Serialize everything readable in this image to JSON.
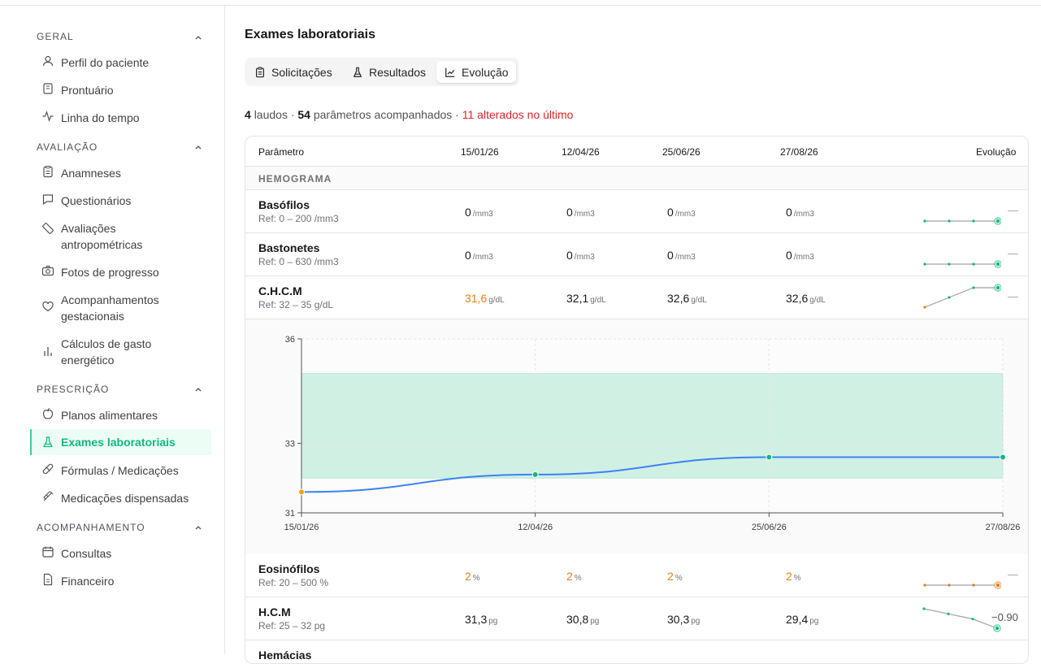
{
  "sidebar": {
    "sections": [
      {
        "title": "GERAL",
        "items": [
          "Perfil do paciente",
          "Prontuário",
          "Linha do tempo"
        ]
      },
      {
        "title": "AVALIAÇÃO",
        "items": [
          "Anamneses",
          "Questionários",
          "Avaliações antropométricas",
          "Fotos de progresso",
          "Acompanhamentos gestacionais",
          "Cálculos de gasto energético"
        ]
      },
      {
        "title": "PRESCRIÇÃO",
        "items": [
          "Planos alimentares",
          "Exames laboratoriais",
          "Fórmulas / Medicações",
          "Medicações dispensadas"
        ]
      },
      {
        "title": "ACOMPANHAMENTO",
        "items": [
          "Consultas",
          "Financeiro"
        ]
      }
    ],
    "labels": {
      "geral": "GERAL",
      "avaliacao": "AVALIAÇÃO",
      "prescricao": "PRESCRIÇÃO",
      "acompanhamento": "ACOMPANHAMENTO",
      "perfil": "Perfil do paciente",
      "prontuario": "Prontuário",
      "linha": "Linha do tempo",
      "anamneses": "Anamneses",
      "questionarios": "Questionários",
      "antropo1": "Avaliações",
      "antropo2": "antropométricas",
      "fotos": "Fotos de progresso",
      "gest1": "Acompanhamentos",
      "gest2": "gestacionais",
      "calc1": "Cálculos de gasto",
      "calc2": "energético",
      "planos": "Planos alimentares",
      "exames": "Exames laboratoriais",
      "formulas": "Fórmulas / Medicações",
      "medicacoes": "Medicações dispensadas",
      "consultas": "Consultas",
      "financeiro": "Financeiro"
    },
    "active": "Exames laboratoriais"
  },
  "page": {
    "title": "Exames laboratoriais",
    "tabs": {
      "solicitacoes": "Solicitações",
      "resultados": "Resultados",
      "evolucao": "Evolução"
    },
    "selected_tab": "Evolução",
    "summary": {
      "laudos_count": "4",
      "laudos_label": "laudos ·",
      "params_count": "54",
      "params_label": "parâmetros acompanhados ·",
      "altered": "11 alterados no último"
    }
  },
  "table": {
    "headers": {
      "param": "Parâmetro",
      "d1": "15/01/26",
      "d2": "12/04/26",
      "d3": "25/06/26",
      "d4": "27/08/26",
      "evo": "Evolução"
    },
    "group": "HEMOGRAMA",
    "rows": [
      {
        "name": "Basófilos",
        "ref": "Ref: 0 – 200 /mm3",
        "unit": "/mm3",
        "values": [
          "0",
          "0",
          "0",
          "0"
        ],
        "altered": [
          false,
          false,
          false,
          false
        ],
        "trend": "—"
      },
      {
        "name": "Bastonetes",
        "ref": "Ref: 0 – 630 /mm3",
        "unit": "/mm3",
        "values": [
          "0",
          "0",
          "0",
          "0"
        ],
        "altered": [
          false,
          false,
          false,
          false
        ],
        "trend": "—"
      },
      {
        "name": "C.H.C.M",
        "ref": "Ref: 32 – 35 g/dL",
        "unit": "g/dL",
        "values": [
          "31,6",
          "32,1",
          "32,6",
          "32,6"
        ],
        "altered": [
          true,
          false,
          false,
          false
        ],
        "trend": "—"
      },
      {
        "name": "Eosinófilos",
        "ref": "Ref: 20 – 500 %",
        "unit": "%",
        "values": [
          "2",
          "2",
          "2",
          "2"
        ],
        "altered": [
          true,
          true,
          true,
          true
        ],
        "trend": "—"
      },
      {
        "name": "H.C.M",
        "ref": "Ref: 25 – 32 pg",
        "unit": "pg",
        "values": [
          "31,3",
          "30,8",
          "30,3",
          "29,4"
        ],
        "altered": [
          false,
          false,
          false,
          false
        ],
        "trend": "−0.90"
      },
      {
        "name": "Hemácias",
        "ref": "",
        "unit": "",
        "values": [
          "",
          "",
          "",
          ""
        ],
        "altered": [
          false,
          false,
          false,
          false
        ],
        "trend": ""
      }
    ]
  },
  "chart_data": {
    "type": "line",
    "x": [
      "15/01/26",
      "12/04/26",
      "25/06/26",
      "27/08/26"
    ],
    "series": [
      {
        "values": [
          31.6,
          32.1,
          32.6,
          32.6
        ]
      }
    ],
    "reference_range": [
      32,
      35
    ],
    "ylim": [
      31,
      36
    ],
    "yticks": [
      "31",
      "33",
      "36"
    ],
    "point_colors": [
      "#f59e0b",
      "#10b981",
      "#10b981",
      "#10b981"
    ],
    "line_color": "#3b82f6",
    "band_color": "#d1f0e4"
  },
  "colors": {
    "accent": "#10b981",
    "altered": "#ea7d16",
    "danger": "#dc2626",
    "line": "#3b82f6"
  }
}
